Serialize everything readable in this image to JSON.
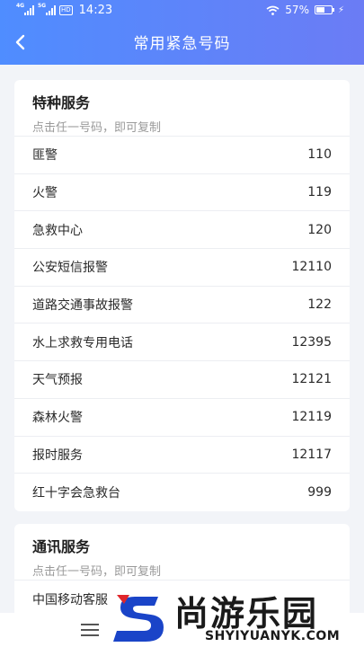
{
  "status_bar": {
    "net_1": "4G",
    "net_2": "5G",
    "hd": "HD",
    "time": "14:23",
    "battery": "57%",
    "battery_level": 0.57
  },
  "header": {
    "title": "常用紧急号码"
  },
  "sections": [
    {
      "title": "特种服务",
      "hint": "点击任一号码，即可复制",
      "items": [
        {
          "name": "匪警",
          "number": "110"
        },
        {
          "name": "火警",
          "number": "119"
        },
        {
          "name": "急救中心",
          "number": "120"
        },
        {
          "name": "公安短信报警",
          "number": "12110"
        },
        {
          "name": "道路交通事故报警",
          "number": "122"
        },
        {
          "name": "水上求救专用电话",
          "number": "12395"
        },
        {
          "name": "天气预报",
          "number": "12121"
        },
        {
          "name": "森林火警",
          "number": "12119"
        },
        {
          "name": "报时服务",
          "number": "12117"
        },
        {
          "name": "红十字会急救台",
          "number": "999"
        }
      ]
    },
    {
      "title": "通讯服务",
      "hint": "点击任一号码，即可复制",
      "items": [
        {
          "name": "中国移动客服",
          "number": ""
        }
      ]
    }
  ],
  "watermark": {
    "text": "尚游乐园",
    "url": "SHYIYUANYK.COM",
    "colors": {
      "blue": "#1a44c8",
      "red": "#e0262b"
    }
  },
  "colors": {
    "header_start": "#4f8dff",
    "header_end": "#6b7cf5",
    "background": "#f2f4f8"
  }
}
